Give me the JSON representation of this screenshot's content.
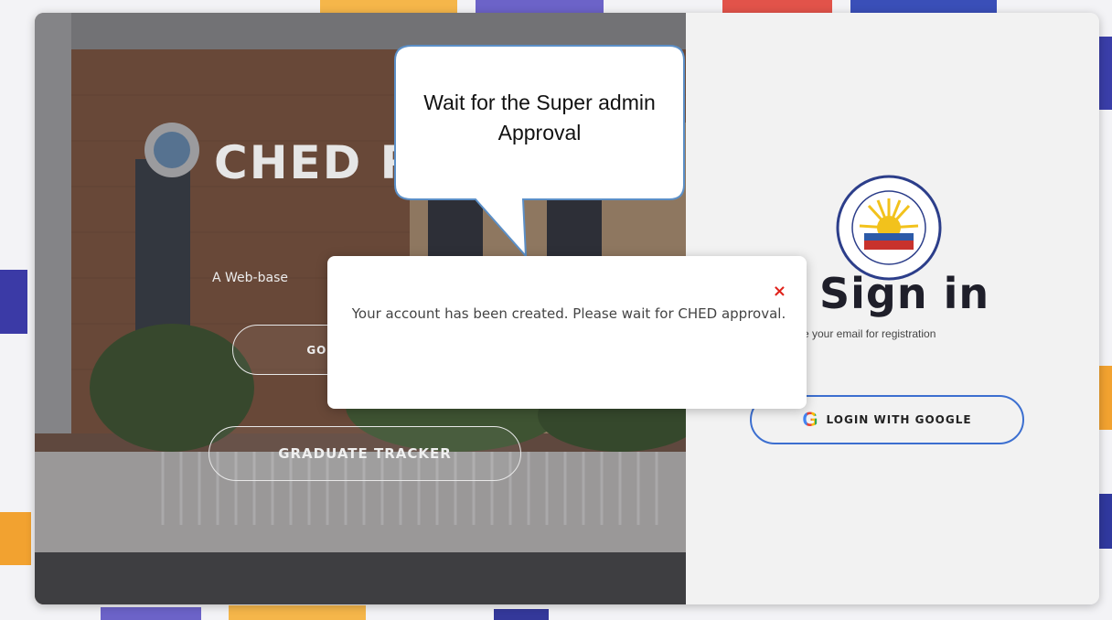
{
  "hero": {
    "title": "CHED R",
    "subtitle": "A Web-base",
    "go_back_label": "GO B",
    "tracker_label": "GRADUATE TRACKER"
  },
  "signin": {
    "title": "Sign in",
    "note": "e your email for registration",
    "google_label": "LOGIN WITH GOOGLE",
    "google_icon": "G"
  },
  "modal": {
    "message": "Your account has been created. Please wait for CHED approval.",
    "close": "×"
  },
  "callout": {
    "text": "Wait for the Super admin Approval"
  },
  "colors": {
    "accent": "#3c6fd0",
    "close": "#e0231c",
    "callout_border": "#5b8fc7"
  }
}
